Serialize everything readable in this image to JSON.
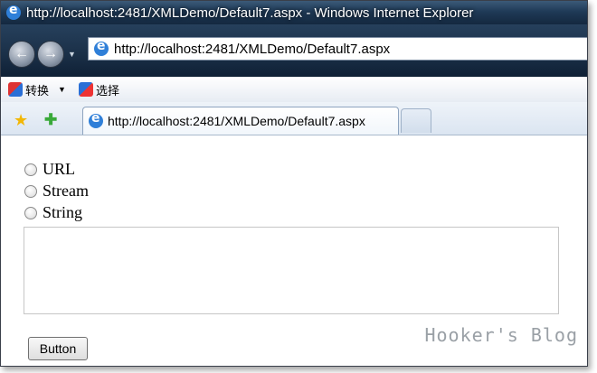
{
  "window": {
    "title": "http://localhost:2481/XMLDemo/Default7.aspx - Windows Internet Explorer"
  },
  "address_bar": {
    "url": "http://localhost:2481/XMLDemo/Default7.aspx"
  },
  "command_bar": {
    "convert_label": "转换",
    "select_label": "选择"
  },
  "tabs": [
    {
      "label": "http://localhost:2481/XMLDemo/Default7.aspx"
    }
  ],
  "form": {
    "radio_options": [
      {
        "label": "URL",
        "checked": false
      },
      {
        "label": "Stream",
        "checked": false
      },
      {
        "label": "String",
        "checked": false
      }
    ],
    "textarea_value": "",
    "button_label": "Button"
  },
  "watermark": "Hooker's Blog",
  "icons": {
    "back": "back-arrow-icon",
    "forward": "forward-arrow-icon",
    "favorites": "star-icon",
    "add_favorite": "add-favorite-icon",
    "page": "ie-page-icon"
  }
}
